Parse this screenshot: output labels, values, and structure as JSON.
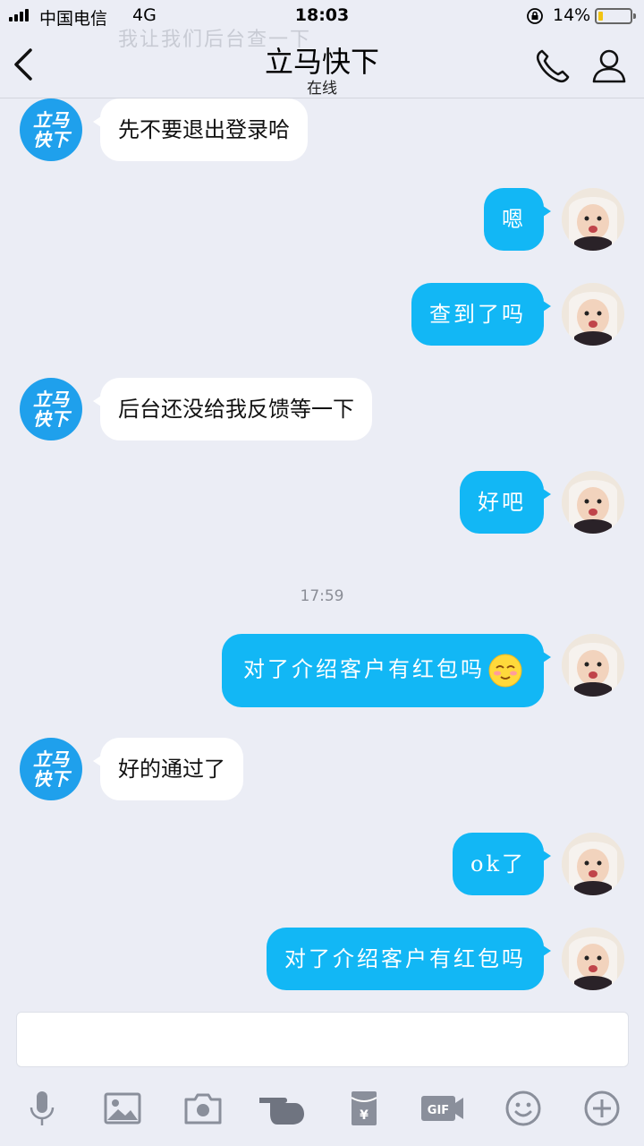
{
  "status": {
    "carrier": "中国电信",
    "network": "4G",
    "time": "18:03",
    "battery": "14%",
    "battery_level": 0.14,
    "battery_color": "#f2c413"
  },
  "header": {
    "title": "立马快下",
    "subtitle": "在线",
    "ghost_text": "我让我们后台查一下",
    "icons": [
      "back-arrow-icon",
      "phone-icon",
      "profile-icon"
    ]
  },
  "contact": {
    "avatar_text_line1": "立马",
    "avatar_text_line2": "快下",
    "avatar_color": "#1fa0ec"
  },
  "messages": [
    {
      "side": "in",
      "text": "先不要退出登录哈"
    },
    {
      "side": "out",
      "text": "嗯"
    },
    {
      "side": "out",
      "text": "查到了吗"
    },
    {
      "side": "in",
      "text": "后台还没给我反馈等一下"
    },
    {
      "side": "out",
      "text": "好吧"
    },
    {
      "side": "time",
      "text": "17:59"
    },
    {
      "side": "out",
      "text": "对了介绍客户有红包吗",
      "emoji": "blush-emoji-icon"
    },
    {
      "side": "in",
      "text": "好的通过了"
    },
    {
      "side": "out",
      "text": "ok了"
    },
    {
      "side": "out",
      "text": "对了介绍客户有红包吗"
    }
  ],
  "colors": {
    "background": "#ebedf5",
    "outgoing_bubble": "#12b7f5",
    "incoming_bubble": "#ffffff"
  },
  "input": {
    "placeholder": ""
  },
  "toolbar": [
    "mic-icon",
    "image-icon",
    "camera-icon",
    "poke-hand-icon",
    "red-packet-icon",
    "gif-icon",
    "emoji-icon",
    "plus-icon"
  ]
}
